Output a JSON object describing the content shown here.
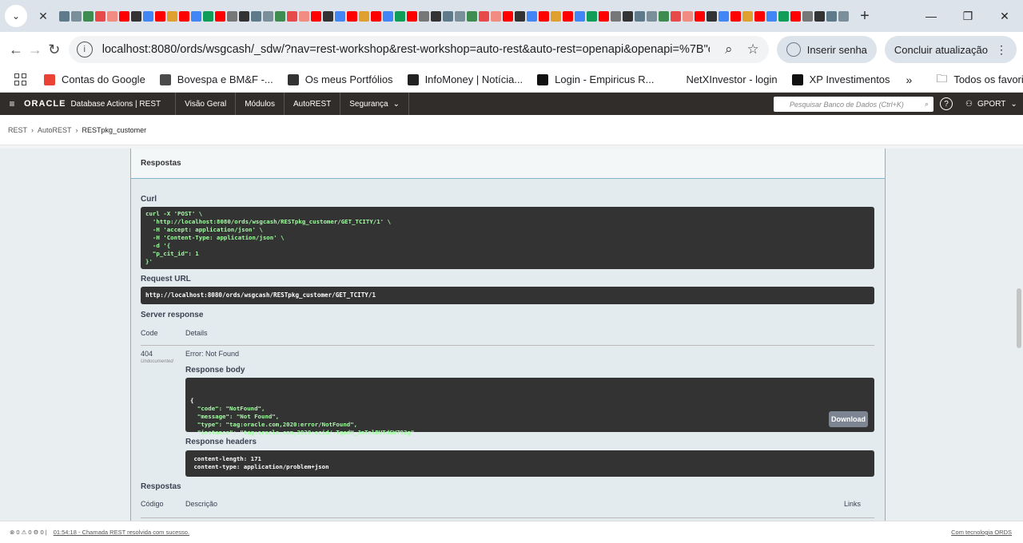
{
  "browser": {
    "new_tab_symbol": "+",
    "url": "localhost:8080/ords/wsgcash/_sdw/?nav=rest-workshop&rest-workshop=auto-rest&auto-rest=openapi&openapi=%7B\"o...",
    "password_pill": "Inserir senha",
    "update_pill": "Concluir atualização"
  },
  "bookmarks": [
    {
      "label": "Contas do Google",
      "color": "#ea4335"
    },
    {
      "label": "Bovespa e BM&F -...",
      "color": "#4a4a4a"
    },
    {
      "label": "Os meus Portfólios",
      "color": "#333333"
    },
    {
      "label": "InfoMoney | Notícia...",
      "color": "#222222"
    },
    {
      "label": "Login - Empiricus R...",
      "color": "#111111"
    },
    {
      "label": "NetXInvestor - login",
      "color": "#ffffff"
    },
    {
      "label": "XP Investimentos",
      "color": "#111111"
    }
  ],
  "bookmarks_all": "Todos os favoritos",
  "oracle": {
    "logo": "ORACLE",
    "product": "Database Actions | REST",
    "nav": [
      "Visão Geral",
      "Módulos",
      "AutoREST",
      "Segurança"
    ],
    "search_placeholder": "Pesquisar Banco de Dados (Ctrl+K)",
    "user": "GPORT"
  },
  "breadcrumb": [
    "REST",
    "AutoREST",
    "RESTpkg_customer"
  ],
  "panel": {
    "header": "Respostas",
    "curl_title": "Curl",
    "curl_lines": [
      "curl -X 'POST' \\",
      "  'http://localhost:8080/ords/wsgcash/RESTpkg_customer/GET_TCITY/1' \\",
      "  -H 'accept: application/json' \\",
      "  -H 'Content-Type: application/json' \\",
      "  -d '{",
      "  \"p_cit_id\": 1",
      "}'"
    ],
    "request_url_title": "Request URL",
    "request_url": "http://localhost:8080/ords/wsgcash/RESTpkg_customer/GET_TCITY/1",
    "server_response_title": "Server response",
    "col_code": "Code",
    "col_details": "Details",
    "status_code": "404",
    "undocumented": "Undocumented",
    "error_text": "Error: Not Found",
    "response_body_title": "Response body",
    "response_body_lines": [
      "{",
      "  \"code\": \"NotFound\",",
      "  \"message\": \"Not Found\",",
      "  \"type\": \"tag:oracle.com,2020:error/NotFound\",",
      "  \"instance\": \"tag:oracle.com,2020:ecid/-TqedH_JnTnlBUTdGW792g\"",
      "}"
    ],
    "download_label": "Download",
    "response_headers_title": "Response headers",
    "response_headers_lines": [
      " content-length: 171",
      " content-type: application/problem+json"
    ],
    "responses_title": "Respostas",
    "col_codigo": "Código",
    "col_descricao": "Descrição",
    "col_links": "Links"
  },
  "status": {
    "counts": "⊗ 0  ⚠ 0  ⚙ 0  |",
    "message": "01:54:18 - Chamada REST resolvida com sucesso.",
    "right": "Com tecnologia ORDS"
  }
}
